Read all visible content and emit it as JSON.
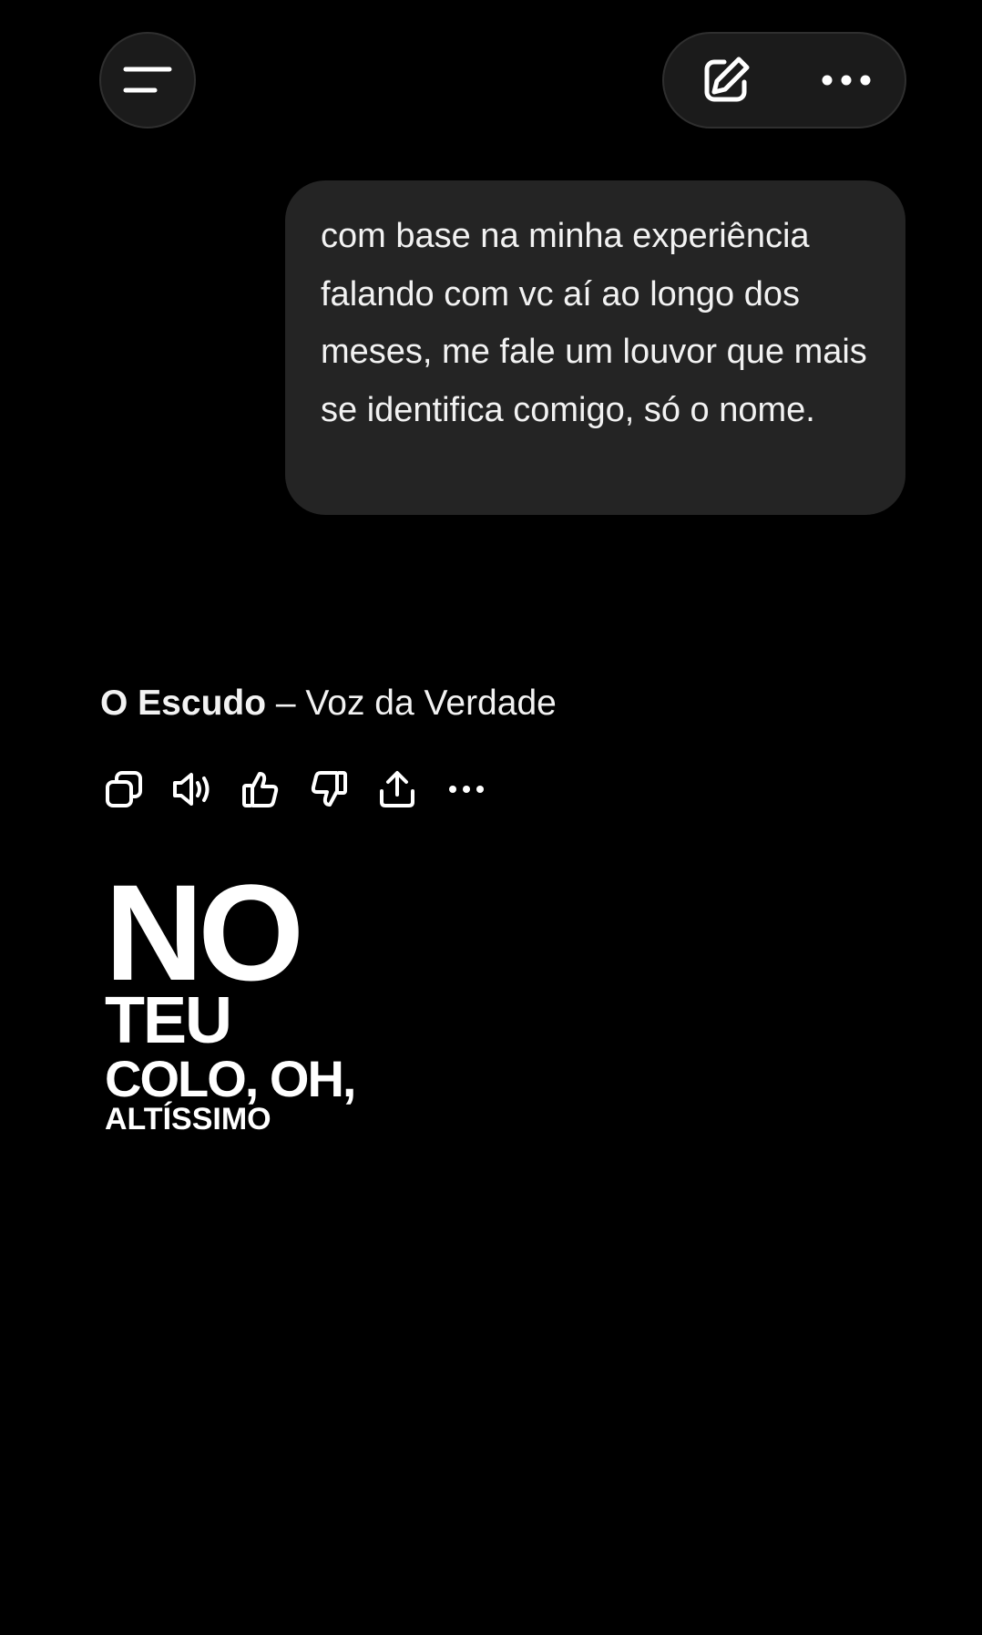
{
  "header": {
    "menu_icon": "hamburger-menu-icon",
    "compose_icon": "new-chat-edit-icon",
    "more_icon": "more-horizontal-icon"
  },
  "conversation": {
    "user_message": "com base na minha experiência falando com vc aí ao longo dos meses, me fale um louvor que mais se identifica comigo, só o nome.",
    "assistant_reply": {
      "song_title": "O Escudo",
      "separator": " – ",
      "artist": "Voz da Verdade"
    }
  },
  "actions": [
    {
      "name": "copy-icon"
    },
    {
      "name": "read-aloud-icon"
    },
    {
      "name": "thumbs-up-icon"
    },
    {
      "name": "thumbs-down-icon"
    },
    {
      "name": "share-icon"
    },
    {
      "name": "more-options-icon"
    }
  ],
  "lyric_image": {
    "line1": "NO",
    "line2": "TEU",
    "line3": "COLO, OH,",
    "line4": "ALTÍSSIMO"
  },
  "colors": {
    "background": "#000000",
    "bubble": "#242424",
    "button_bg": "#1b1b1b",
    "text": "#f2f2f2"
  }
}
